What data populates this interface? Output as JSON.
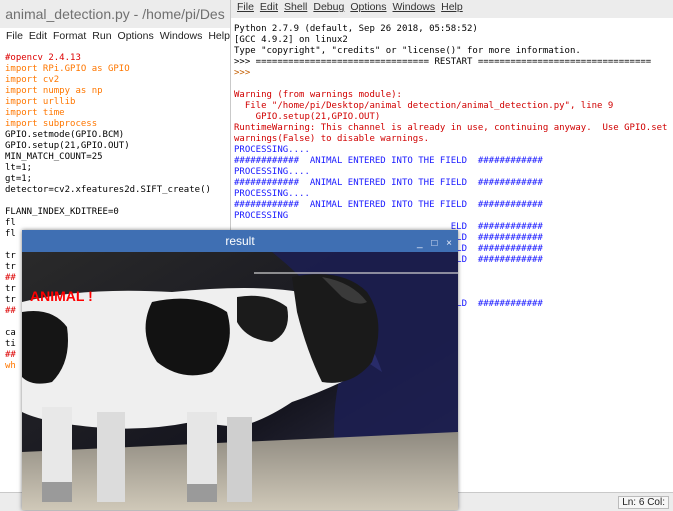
{
  "editor": {
    "title": "animal_detection.py - /home/pi/Des",
    "menu": [
      "File",
      "Edit",
      "Format",
      "Run",
      "Options",
      "Windows",
      "Help"
    ],
    "code": [
      {
        "t": "#opencv 2.4.13",
        "c": "cm"
      },
      {
        "t": "import RPi.GPIO as GPIO",
        "c": "kw"
      },
      {
        "t": "import cv2",
        "c": "kw"
      },
      {
        "t": "import numpy as np",
        "c": "kw"
      },
      {
        "t": "import urllib",
        "c": "kw"
      },
      {
        "t": "import time",
        "c": "kw"
      },
      {
        "t": "import subprocess",
        "c": "kw"
      },
      {
        "t": "GPIO.setmode(GPIO.BCM)",
        "c": "blk"
      },
      {
        "t": "GPIO.setup(21,GPIO.OUT)",
        "c": "blk"
      },
      {
        "t": "MIN_MATCH_COUNT=25",
        "c": "blk"
      },
      {
        "t": "lt=1;",
        "c": "blk"
      },
      {
        "t": "gt=1;",
        "c": "blk"
      },
      {
        "t": "detector=cv2.xfeatures2d.SIFT_create()",
        "c": "blk"
      },
      {
        "t": "",
        "c": "blk"
      },
      {
        "t": "FLANN_INDEX_KDITREE=0",
        "c": "blk"
      },
      {
        "t": "fl",
        "c": "blk"
      },
      {
        "t": "fl",
        "c": "blk"
      },
      {
        "t": "",
        "c": "blk"
      },
      {
        "t": "tr",
        "c": "blk"
      },
      {
        "t": "tr",
        "c": "blk"
      },
      {
        "t": "##",
        "c": "cm"
      },
      {
        "t": "tr",
        "c": "blk"
      },
      {
        "t": "tr",
        "c": "blk"
      },
      {
        "t": "##",
        "c": "cm"
      },
      {
        "t": "",
        "c": "blk"
      },
      {
        "t": "ca",
        "c": "blk"
      },
      {
        "t": "ti",
        "c": "blk"
      },
      {
        "t": "##",
        "c": "cm"
      },
      {
        "t": "wh",
        "c": "kw"
      }
    ]
  },
  "shell": {
    "menu": [
      "File",
      "Edit",
      "Shell",
      "Debug",
      "Options",
      "Windows",
      "Help"
    ],
    "lines": [
      {
        "t": "Python 2.7.9 (default, Sep 26 2018, 05:58:52)",
        "c": "blk"
      },
      {
        "t": "[GCC 4.9.2] on linux2",
        "c": "blk"
      },
      {
        "t": "Type \"copyright\", \"credits\" or \"license()\" for more information.",
        "c": "blk"
      },
      {
        "t": ">>> ================================ RESTART ================================",
        "c": "blk"
      },
      {
        "t": ">>>",
        "c": "orange"
      },
      {
        "t": "",
        "c": "blk"
      },
      {
        "t": "Warning (from warnings module):",
        "c": "red"
      },
      {
        "t": "  File \"/home/pi/Desktop/animal detection/animal_detection.py\", line 9",
        "c": "red"
      },
      {
        "t": "    GPIO.setup(21,GPIO.OUT)",
        "c": "red"
      },
      {
        "t": "RuntimeWarning: This channel is already in use, continuing anyway.  Use GPIO.set",
        "c": "red"
      },
      {
        "t": "warnings(False) to disable warnings.",
        "c": "red"
      },
      {
        "t": "PROCESSING....",
        "c": "blue"
      },
      {
        "t": "############  ANIMAL ENTERED INTO THE FIELD  ############",
        "c": "blue"
      },
      {
        "t": "PROCESSING....",
        "c": "blue"
      },
      {
        "t": "############  ANIMAL ENTERED INTO THE FIELD  ############",
        "c": "blue"
      },
      {
        "t": "PROCESSING....",
        "c": "blue"
      },
      {
        "t": "############  ANIMAL ENTERED INTO THE FIELD  ############",
        "c": "blue"
      },
      {
        "t": "PROCESSING",
        "c": "blue"
      },
      {
        "t": "                                        ELD  ############",
        "c": "blue"
      },
      {
        "t": "                                        ELD  ############",
        "c": "blue"
      },
      {
        "t": "                                        ELD  ############",
        "c": "blue"
      },
      {
        "t": "                                        ELD  ############",
        "c": "blue"
      },
      {
        "t": "",
        "c": "blk"
      },
      {
        "t": "",
        "c": "blk"
      },
      {
        "t": "",
        "c": "blk"
      },
      {
        "t": "                                        ELD  ############",
        "c": "blue"
      }
    ]
  },
  "status": {
    "position": "Ln: 6 Col:"
  },
  "result_window": {
    "title": "result",
    "controls": [
      "_",
      "□",
      "×"
    ],
    "overlay_text": "ANIMAL !"
  }
}
